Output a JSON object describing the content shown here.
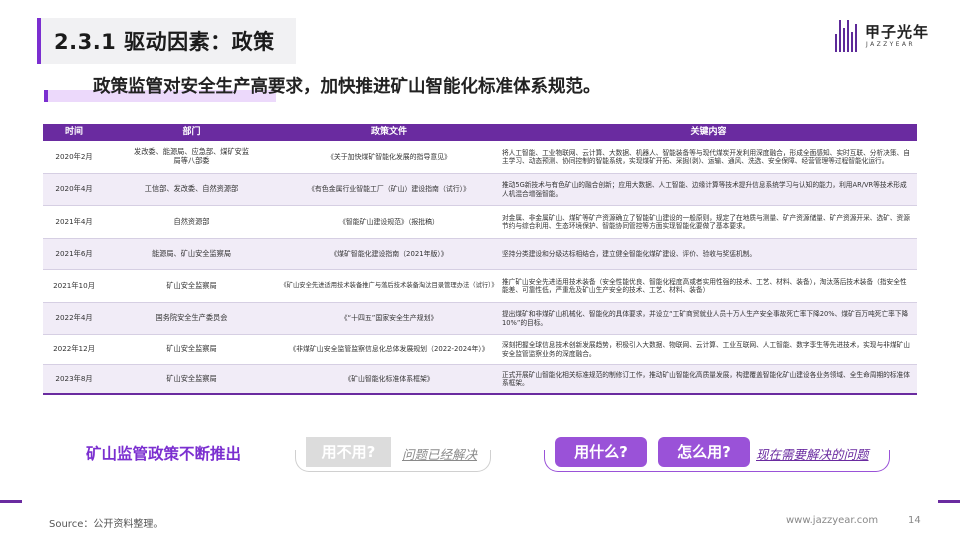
{
  "header": {
    "section_title": "2.3.1 驱动因素：政策",
    "subtitle": "政策监管对安全生产高要求，加快推进矿山智能化标准体系规范。",
    "logo_cn": "甲子光年",
    "logo_en": "JAZZYEAR"
  },
  "colors": {
    "accent": "#6a2ba0",
    "accent_light": "#9a52d8",
    "muted": "#dcdcdc"
  },
  "table": {
    "columns": [
      "时间",
      "部门",
      "政策文件",
      "关键内容"
    ],
    "rows": [
      {
        "time": "2020年2月",
        "dept": "发改委、能源局、应急部、煤矿安监局等八部委",
        "doc": "《关于加快煤矿智能化发展的指导意见》",
        "key": "将人工智能、工业物联网、云计算、大数据、机器人、智能装备等与现代煤炭开发利用深度融合，形成全面感知、实时互联、分析决策、自主学习、动态预测、协同控制的智能系统，实现煤矿开拓、采掘(剥)、运输、通风、洗选、安全保障、经营管理等过程智能化运行。"
      },
      {
        "time": "2020年4月",
        "dept": "工信部、发改委、自然资源部",
        "doc": "《有色金属行业智能工厂（矿山）建设指南（试行）》",
        "key": "推动5G新技术与有色矿山的融合创新；应用大数据、人工智能、边缘计算等技术提升信息系统学习与认知的能力，利用AR/VR等技术形成人机混合增强智能。"
      },
      {
        "time": "2021年4月",
        "dept": "自然资源部",
        "doc": "《智能矿山建设规范》（报批稿）",
        "key": "对金属、非金属矿山、煤矿等矿产资源确立了智能矿山建设的一般原则，规定了在地质与测量、矿产资源储量、矿产资源开采、选矿、资源节约与综合利用、生态环境保护、智能协同管控等方面实现智能化要做了基本要求。"
      },
      {
        "time": "2021年6月",
        "dept": "能源局、矿山安全监察局",
        "doc": "《煤矿智能化建设指南（2021年版）》",
        "key": "坚持分类建设和分级达标相结合，建立健全智能化煤矿建设、评价、验收与奖惩机制。"
      },
      {
        "time": "2021年10月",
        "dept": "矿山安全监察局",
        "doc": "《矿山安全先进适用技术装备推广与落后技术装备淘汰目录管理办法（试行）》",
        "key": "推广矿山安全先进适用技术装备（安全性能优良、智能化程度高或者实用性强的技术、工艺、材料、装备），淘汰落后技术装备（指安全性能差、可靠性低，严重危及矿山生产安全的技术、工艺、材料、装备）"
      },
      {
        "time": "2022年4月",
        "dept": "国务院安全生产委员会",
        "doc": "《“十四五”国家安全生产规划》",
        "key": "提出煤矿和非煤矿山机械化、智能化的具体要求，并设立“工矿商贸就业人员十万人生产安全事故死亡率下降20%、煤矿百万吨死亡率下降10%”的目标。"
      },
      {
        "time": "2022年12月",
        "dept": "矿山安全监察局",
        "doc": "《非煤矿山安全监管监察信息化总体发展规划（2022-2024年）》",
        "key": "深刻把握全球信息技术创新发展趋势，积极引入大数据、物联网、云计算、工业互联网、人工智能、数字孪生等先进技术，实现与非煤矿山安全监管监察业务的深度融合。"
      },
      {
        "time": "2023年8月",
        "dept": "矿山安全监察局",
        "doc": "《矿山智能化标准体系框架》",
        "key": "正式开展矿山智能化相关标准规范的制修订工作，推动矿山智能化高质量发展，构建覆盖智能化矿山建设各业务领域、全生命周期的标准体系框架。"
      }
    ]
  },
  "flow": {
    "label": "矿山监管政策不断推出",
    "step1": "用不用?",
    "note1": "问题已经解决",
    "step2": "用什么?",
    "step3": "怎么用?",
    "note2": "现在需要解决的问题"
  },
  "footer": {
    "source": "Source：公开资料整理。",
    "site": "www.jazzyear.com",
    "page": "14"
  }
}
